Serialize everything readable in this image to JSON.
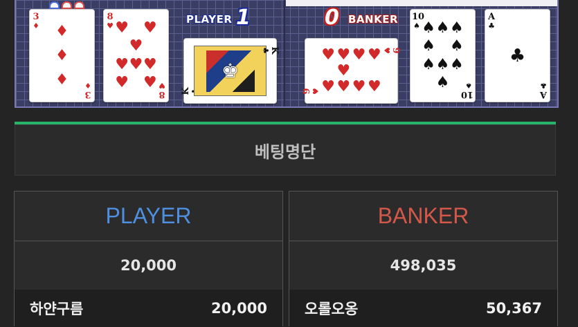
{
  "table": {
    "player_label": "PLAYER",
    "player_score": "1",
    "banker_label": "BANKER",
    "banker_score": "0",
    "player_cards": [
      {
        "rank": "3",
        "suit": "♦",
        "color": "red"
      },
      {
        "rank": "8",
        "suit": "♥",
        "color": "red"
      },
      {
        "rank": "K",
        "suit": "♣",
        "color": "black"
      }
    ],
    "banker_cards": [
      {
        "rank": "9",
        "suit": "♥",
        "color": "red"
      },
      {
        "rank": "10",
        "suit": "♠",
        "color": "black"
      },
      {
        "rank": "A",
        "suit": "♣",
        "color": "black"
      }
    ]
  },
  "bet_list": {
    "title": "베팅명단",
    "accent_color": "#27b36a",
    "player": {
      "header": "PLAYER",
      "total": "20,000",
      "rows": [
        {
          "name": "하얀구름",
          "amount": "20,000"
        }
      ]
    },
    "banker": {
      "header": "BANKER",
      "total": "498,035",
      "rows": [
        {
          "name": "오롤오옹",
          "amount": "50,367"
        }
      ]
    }
  },
  "colors": {
    "player": "#4e8fe0",
    "banker": "#d4584a",
    "table_bg": "#3a3d64"
  }
}
